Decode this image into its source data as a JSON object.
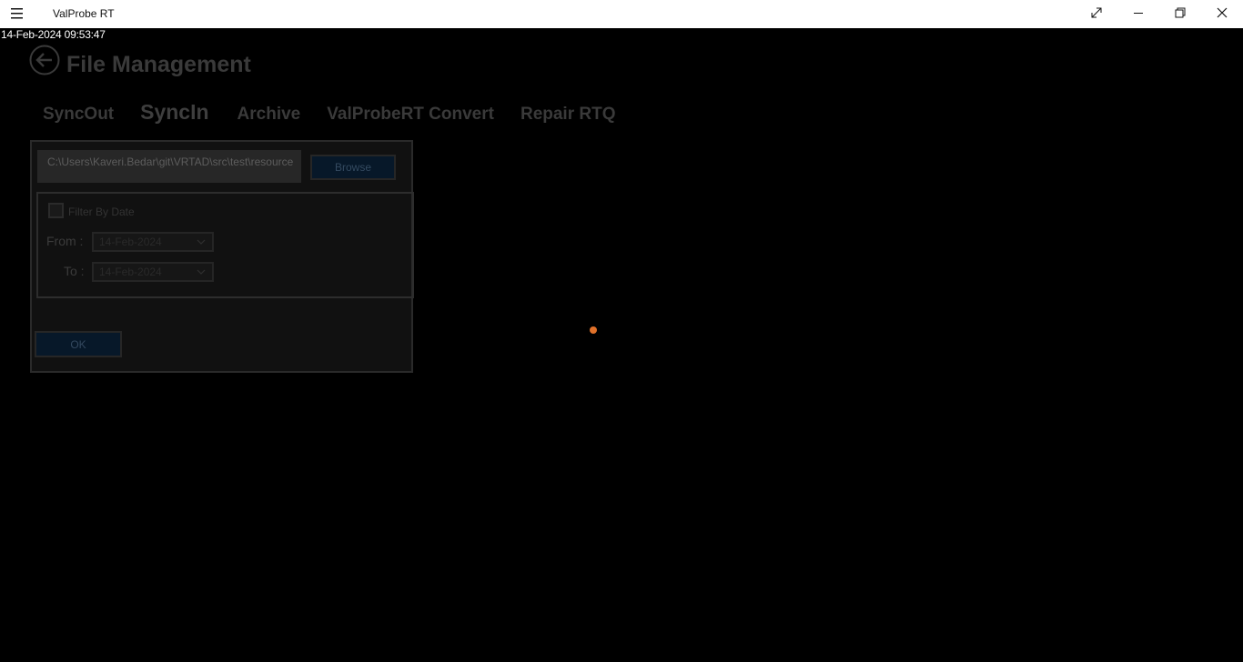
{
  "window": {
    "title": "ValProbe RT"
  },
  "status": {
    "timestamp": "14-Feb-2024 09:53:47"
  },
  "page": {
    "title": "File Management"
  },
  "tabs": [
    {
      "label": "SyncOut"
    },
    {
      "label": "SyncIn",
      "active": true
    },
    {
      "label": "Archive"
    },
    {
      "label": "ValProbeRT Convert"
    },
    {
      "label": "Repair RTQ"
    }
  ],
  "sync_in": {
    "path_value": "C:\\Users\\Kaveri.Bedar\\git\\VRTAD\\src\\test\\resource",
    "browse_label": "Browse",
    "filter_label": "Filter By Date",
    "filter_checked": false,
    "from_label": "From :",
    "from_value": "14-Feb-2024",
    "to_label": "To :",
    "to_value": "14-Feb-2024",
    "ok_label": "OK"
  },
  "icons": {
    "menu": "hamburger-icon",
    "back": "back-arrow-icon",
    "fullscreen": "expand-icon",
    "minimize": "minimize-icon",
    "restore": "restore-icon",
    "close": "close-icon",
    "dropdown": "chevron-down-icon",
    "loading": "progress-dot"
  },
  "colors": {
    "background": "#000000",
    "titlebar": "#ffffff",
    "accent_progress": "#e0712a",
    "button_fill": "#071829"
  }
}
